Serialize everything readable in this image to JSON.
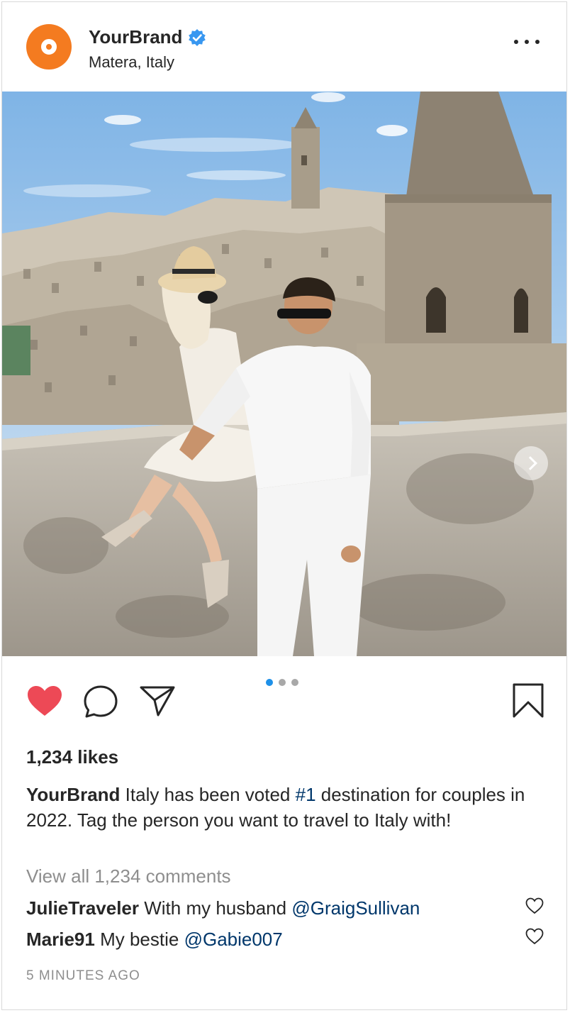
{
  "post": {
    "username": "YourBrand",
    "location": "Matera, Italy",
    "brand_color": "#f47b20",
    "verified_color": "#3897f0"
  },
  "photo": {
    "carousel_total": 3,
    "carousel_active": 1
  },
  "actions": {
    "like_icon": "heart-filled-icon",
    "like_color": "#ed4956",
    "comment_icon": "comment-icon",
    "share_icon": "paper-plane-icon",
    "save_icon": "bookmark-icon"
  },
  "likes_text": "1,234 likes",
  "caption": {
    "username": "YourBrand",
    "text_before": "Italy has been voted",
    "hashtag": "#1",
    "text_after": "destination for couples in 2022. Tag the person you want to travel to Italy with!"
  },
  "view_all_comments": "View all 1,234 comments",
  "comments": [
    {
      "username": "JulieTraveler",
      "text": "With my husband",
      "mention": "@GraigSullivan"
    },
    {
      "username": "Marie91",
      "text": "My bestie",
      "mention": "@Gabie007"
    }
  ],
  "timestamp": "5 MINUTES AGO"
}
